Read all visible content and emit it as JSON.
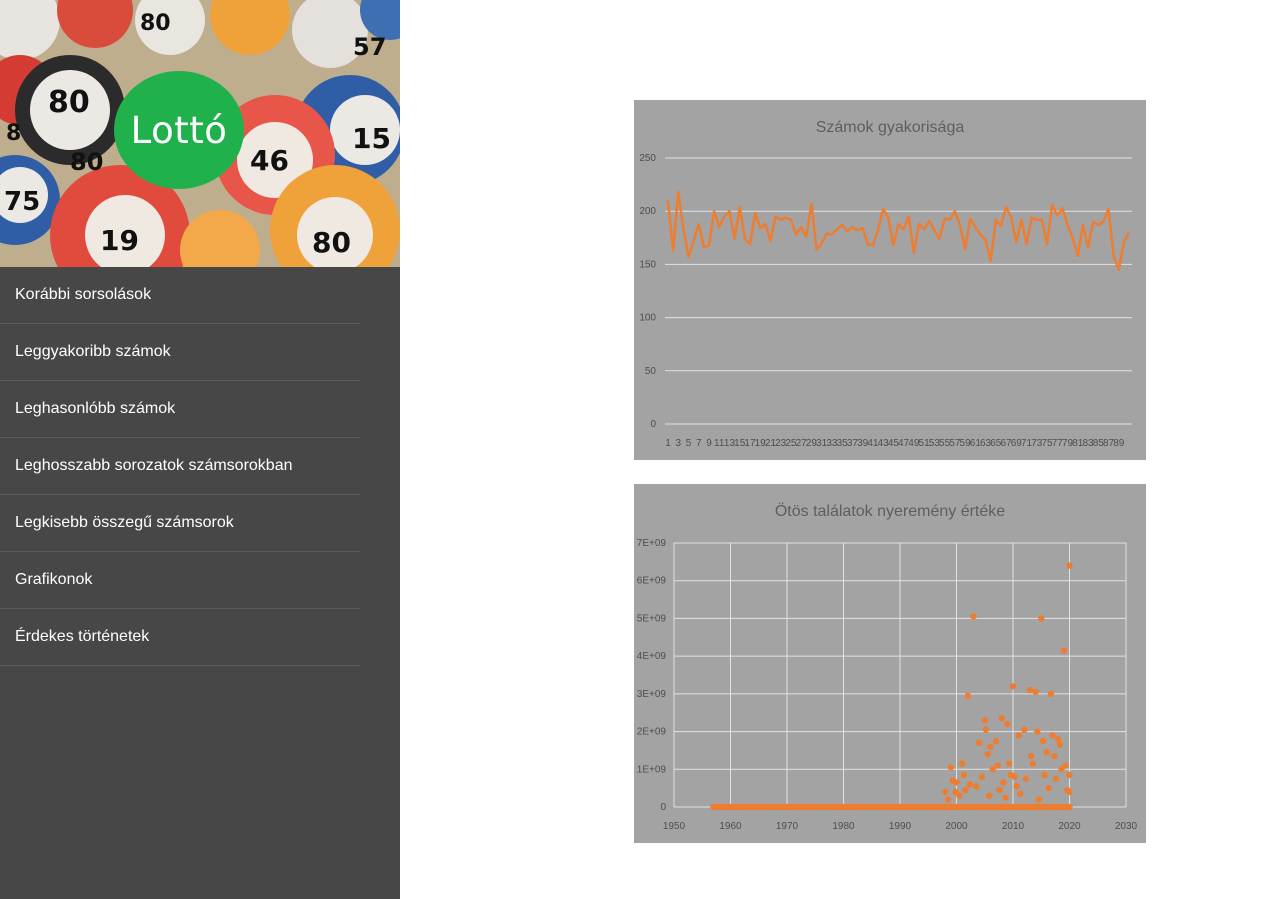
{
  "app": {
    "logo_text": "Lottó"
  },
  "hero": {
    "ball_numbers": [
      "80",
      "46",
      "15",
      "57",
      "75",
      "80",
      "19",
      "80",
      "8",
      "80"
    ]
  },
  "sidebar": {
    "items": [
      {
        "label": "Korábbi sorsolások"
      },
      {
        "label": "Leggyakoribb számok"
      },
      {
        "label": "Leghasonlóbb számok"
      },
      {
        "label": "Leghosszabb sorozatok számsorokban"
      },
      {
        "label": "Legkisebb összegű számsorok"
      },
      {
        "label": "Grafikonok"
      },
      {
        "label": "Érdekes történetek"
      }
    ]
  },
  "colors": {
    "sidebar_bg": "#474747",
    "logo_green": "#21b14c",
    "chart_bg": "#a3a3a3",
    "series_orange": "#ed7d31"
  },
  "chart_data": [
    {
      "type": "line",
      "title": "Számok gyakorisága",
      "x_tick_labels": [
        "1",
        "3",
        "5",
        "7",
        "9",
        "11",
        "13",
        "15",
        "17",
        "19",
        "21",
        "23",
        "25",
        "27",
        "29",
        "31",
        "33",
        "35",
        "37",
        "39",
        "41",
        "43",
        "45",
        "47",
        "49",
        "51",
        "53",
        "55",
        "57",
        "59",
        "61",
        "63",
        "65",
        "67",
        "69",
        "71",
        "73",
        "75",
        "77",
        "79",
        "81",
        "83",
        "85",
        "87",
        "89"
      ],
      "y_ticks": [
        "0",
        "50",
        "100",
        "150",
        "200",
        "250"
      ],
      "ylim": [
        0,
        250
      ],
      "x": [
        1,
        2,
        3,
        4,
        5,
        6,
        7,
        8,
        9,
        10,
        11,
        12,
        13,
        14,
        15,
        16,
        17,
        18,
        19,
        20,
        21,
        22,
        23,
        24,
        25,
        26,
        27,
        28,
        29,
        30,
        31,
        32,
        33,
        34,
        35,
        36,
        37,
        38,
        39,
        40,
        41,
        42,
        43,
        44,
        45,
        46,
        47,
        48,
        49,
        50,
        51,
        52,
        53,
        54,
        55,
        56,
        57,
        58,
        59,
        60,
        61,
        62,
        63,
        64,
        65,
        66,
        67,
        68,
        69,
        70,
        71,
        72,
        73,
        74,
        75,
        76,
        77,
        78,
        79,
        80,
        81,
        82,
        83,
        84,
        85,
        86,
        87,
        88,
        89,
        90
      ],
      "values": [
        210,
        163,
        218,
        184,
        157,
        172,
        188,
        166,
        168,
        200,
        185,
        195,
        200,
        174,
        204,
        174,
        169,
        198,
        184,
        188,
        172,
        195,
        192,
        194,
        192,
        178,
        185,
        176,
        207,
        164,
        170,
        179,
        178,
        183,
        187,
        181,
        185,
        182,
        184,
        169,
        168,
        182,
        202,
        194,
        168,
        188,
        183,
        195,
        161,
        188,
        183,
        191,
        182,
        174,
        193,
        192,
        200,
        187,
        164,
        193,
        185,
        178,
        173,
        153,
        192,
        186,
        204,
        194,
        171,
        192,
        169,
        194,
        192,
        192,
        169,
        206,
        196,
        203,
        187,
        175,
        158,
        187,
        166,
        190,
        187,
        190,
        202,
        158,
        145,
        171,
        180
      ],
      "grid": true
    },
    {
      "type": "scatter",
      "title": "Ötös találatok nyeremény értéke",
      "x_ticks": [
        "1950",
        "1960",
        "1970",
        "1980",
        "1990",
        "2000",
        "2010",
        "2020",
        "2030"
      ],
      "y_ticks": [
        "0",
        "1E+09",
        "2E+09",
        "3E+09",
        "4E+09",
        "5E+09",
        "6E+09",
        "7E+09"
      ],
      "xlim": [
        1950,
        2030
      ],
      "ylim": [
        0,
        7000000000
      ],
      "grid": true,
      "points": [
        [
          1998,
          400000000
        ],
        [
          1998.5,
          200000000
        ],
        [
          1999,
          1050000000
        ],
        [
          1999.3,
          700000000
        ],
        [
          1999.8,
          400000000
        ],
        [
          2000,
          650000000
        ],
        [
          2000.5,
          300000000
        ],
        [
          2001,
          1150000000
        ],
        [
          2001.3,
          850000000
        ],
        [
          2001.6,
          450000000
        ],
        [
          2002,
          2950000000
        ],
        [
          2002.4,
          600000000
        ],
        [
          2003,
          5050000000
        ],
        [
          2003.5,
          550000000
        ],
        [
          2004,
          1700000000
        ],
        [
          2004.5,
          800000000
        ],
        [
          2005,
          2300000000
        ],
        [
          2005.2,
          2050000000
        ],
        [
          2005.5,
          1400000000
        ],
        [
          2005.8,
          300000000
        ],
        [
          2006,
          1600000000
        ],
        [
          2006.4,
          1000000000
        ],
        [
          2007,
          1750000000
        ],
        [
          2007.3,
          1100000000
        ],
        [
          2007.6,
          450000000
        ],
        [
          2008,
          2350000000
        ],
        [
          2008.3,
          650000000
        ],
        [
          2008.7,
          250000000
        ],
        [
          2009,
          2200000000
        ],
        [
          2009.3,
          1150000000
        ],
        [
          2009.6,
          850000000
        ],
        [
          2010,
          3200000000
        ],
        [
          2010.3,
          800000000
        ],
        [
          2010.6,
          550000000
        ],
        [
          2011,
          1900000000
        ],
        [
          2011.3,
          350000000
        ],
        [
          2012,
          2050000000
        ],
        [
          2012.3,
          750000000
        ],
        [
          2013,
          3100000000
        ],
        [
          2013.2,
          1350000000
        ],
        [
          2013.5,
          1150000000
        ],
        [
          2014,
          3050000000
        ],
        [
          2014.3,
          2000000000
        ],
        [
          2014.6,
          200000000
        ],
        [
          2015,
          5000000000
        ],
        [
          2015.3,
          1750000000
        ],
        [
          2015.6,
          850000000
        ],
        [
          2016,
          1450000000
        ],
        [
          2016.3,
          500000000
        ],
        [
          2016.7,
          3000000000
        ],
        [
          2017,
          1900000000
        ],
        [
          2017.3,
          1350000000
        ],
        [
          2017.6,
          750000000
        ],
        [
          2018,
          1800000000
        ],
        [
          2018.3,
          1650000000
        ],
        [
          2018.6,
          1000000000
        ],
        [
          2019,
          4150000000
        ],
        [
          2019.3,
          1100000000
        ],
        [
          2019.6,
          450000000
        ],
        [
          2020,
          6400000000
        ],
        [
          2020,
          850000000
        ],
        [
          2020,
          400000000
        ]
      ]
    }
  ]
}
